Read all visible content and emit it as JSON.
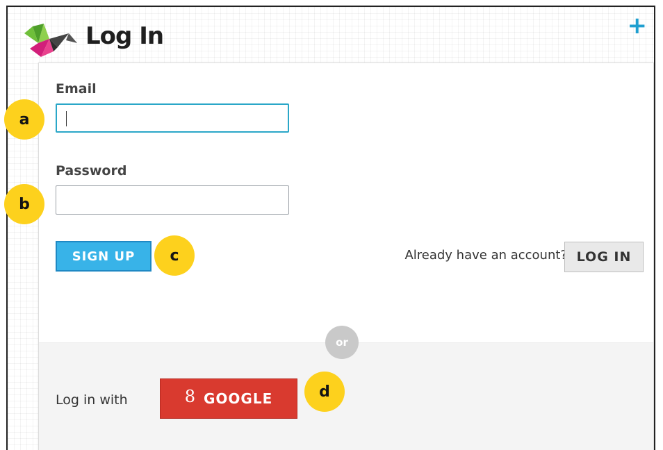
{
  "header": {
    "title": "Log In",
    "plus_icon": "+",
    "logo_icon": "origami-crane-logo"
  },
  "form": {
    "email_label": "Email",
    "email_value": "",
    "password_label": "Password",
    "password_value": "",
    "signup_label": "SIGN UP",
    "already_text": "Already have an account?",
    "login_label": "LOG IN"
  },
  "alt_login": {
    "or_text": "or",
    "login_with_text": "Log in with",
    "google_icon": "8",
    "google_label": "GOOGLE"
  },
  "markers": {
    "a": "a",
    "b": "b",
    "c": "c",
    "d": "d"
  },
  "colors": {
    "accent_blue": "#38b3e8",
    "google_red": "#d93a2f",
    "marker_yellow": "#fdd11d",
    "plus_blue": "#1f9fd0",
    "focus_border": "#2aa7c8"
  }
}
